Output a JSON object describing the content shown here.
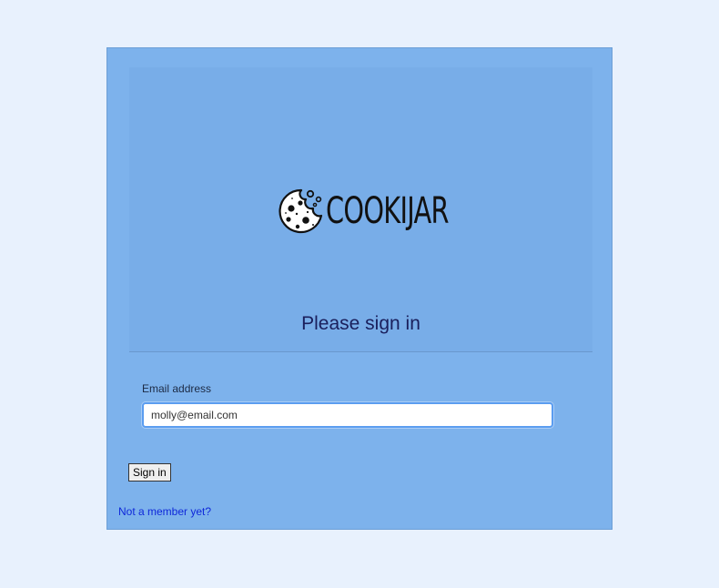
{
  "brand": {
    "name": "COOKIJAR",
    "logo_icon": "cookie-icon"
  },
  "page": {
    "title": "Please sign in"
  },
  "form": {
    "email_label": "Email address",
    "email_value": "molly@email.com",
    "submit_label": "Sign in"
  },
  "links": {
    "signup_text": "Not a member yet?"
  },
  "colors": {
    "page_background": "#e8f1fd",
    "card_background": "#7db2ec",
    "header_background": "#78ade8",
    "title_text": "#1a1f5c",
    "link": "#0f28d9",
    "input_focus": "#5b9df0"
  }
}
